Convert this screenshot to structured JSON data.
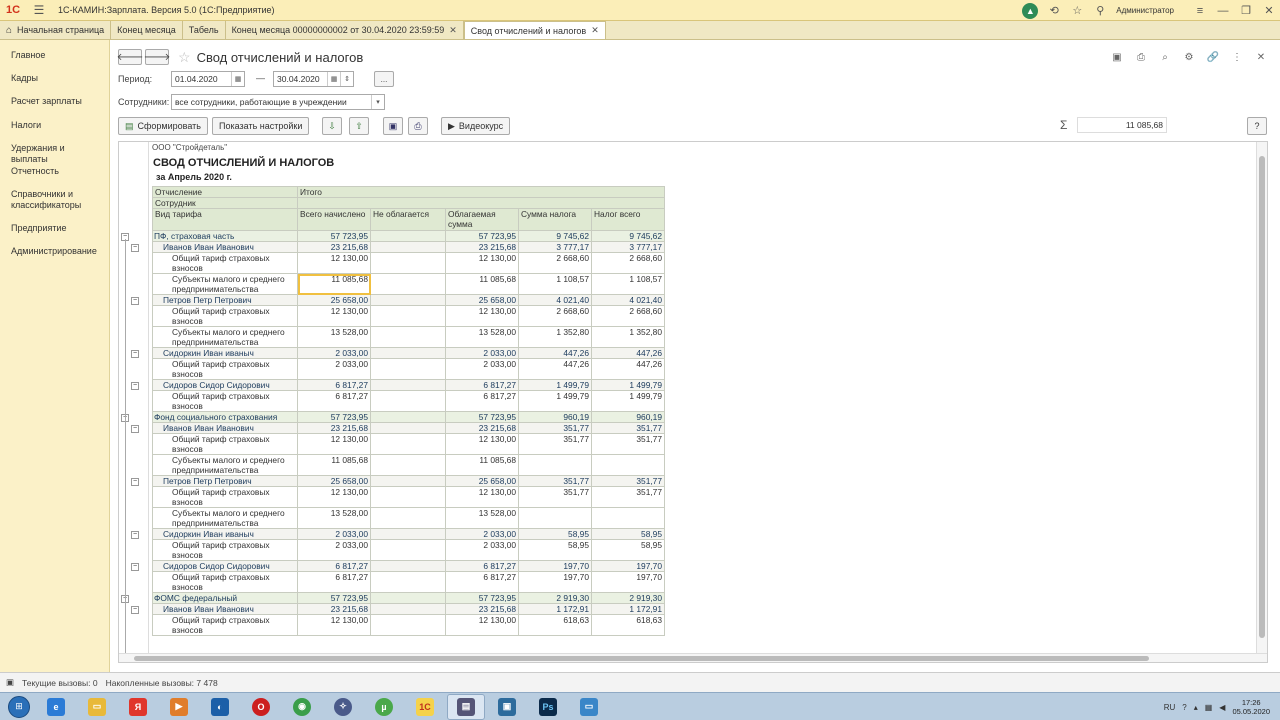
{
  "window": {
    "title": "1С-КАМИН:Зарплата. Версия 5.0  (1С:Предприятие)",
    "user": "Администратор"
  },
  "tabs": [
    {
      "label": "Начальная страница"
    },
    {
      "label": "Конец месяца"
    },
    {
      "label": "Табель"
    },
    {
      "label": "Конец месяца 00000000002 от 30.04.2020 23:59:59"
    },
    {
      "label": "Свод отчислений и налогов"
    }
  ],
  "sidebar": {
    "items": [
      "Главное",
      "Кадры",
      "Расчет зарплаты",
      "Налоги",
      "Удержания и выплаты",
      "Отчетность",
      "Справочники и классификаторы",
      "Предприятие",
      "Администрирование"
    ]
  },
  "form": {
    "title": "Свод отчислений и налогов",
    "period_label": "Период:",
    "date_from": "01.04.2020",
    "dash": "—",
    "date_to": "30.04.2020",
    "ellipsis": "...",
    "employees_label": "Сотрудники:",
    "employees_value": "все сотрудники, работающие в учреждении",
    "btn_generate": "Сформировать",
    "btn_settings": "Показать настройки",
    "btn_video": "Видеокурс",
    "sum_value": "11 085,68",
    "help": "?"
  },
  "report": {
    "org": "ООО \"Стройдеталь\"",
    "title": "СВОД ОТЧИСЛЕНИЙ И НАЛОГОВ",
    "period": "за Апрель 2020 г.",
    "header": {
      "h1": "Отчисление",
      "h_total": "Итого",
      "h2": "Сотрудник",
      "h3": "Вид тарифа",
      "c1": "Всего начислено",
      "c2": "Не облагается",
      "c3": "Облагаемая сумма",
      "c4": "Сумма налога",
      "c5": "Налог всего"
    },
    "rows": [
      {
        "lvl": 0,
        "name": "ПФ, страховая часть",
        "v": [
          "57 723,95",
          "",
          "57 723,95",
          "9 745,62",
          "9 745,62"
        ]
      },
      {
        "lvl": 1,
        "name": "Иванов Иван Иванович",
        "v": [
          "23 215,68",
          "",
          "23 215,68",
          "3 777,17",
          "3 777,17"
        ]
      },
      {
        "lvl": 2,
        "name": "Общий тариф страховых взносов",
        "v": [
          "12 130,00",
          "",
          "12 130,00",
          "2 668,60",
          "2 668,60"
        ]
      },
      {
        "lvl": 2,
        "name": "Субъекты малого и среднего предпринимательства",
        "v": [
          "11 085,68",
          "",
          "11 085,68",
          "1 108,57",
          "1 108,57"
        ],
        "sel": true
      },
      {
        "lvl": 1,
        "name": "Петров Петр Петрович",
        "v": [
          "25 658,00",
          "",
          "25 658,00",
          "4 021,40",
          "4 021,40"
        ]
      },
      {
        "lvl": 2,
        "name": "Общий тариф страховых взносов",
        "v": [
          "12 130,00",
          "",
          "12 130,00",
          "2 668,60",
          "2 668,60"
        ]
      },
      {
        "lvl": 2,
        "name": "Субъекты малого и среднего предпринимательства",
        "v": [
          "13 528,00",
          "",
          "13 528,00",
          "1 352,80",
          "1 352,80"
        ]
      },
      {
        "lvl": 1,
        "name": "Сидоркин Иван иваныч",
        "v": [
          "2 033,00",
          "",
          "2 033,00",
          "447,26",
          "447,26"
        ]
      },
      {
        "lvl": 2,
        "name": "Общий тариф страховых взносов",
        "v": [
          "2 033,00",
          "",
          "2 033,00",
          "447,26",
          "447,26"
        ]
      },
      {
        "lvl": 1,
        "name": "Сидоров Сидор Сидорович",
        "v": [
          "6 817,27",
          "",
          "6 817,27",
          "1 499,79",
          "1 499,79"
        ]
      },
      {
        "lvl": 2,
        "name": "Общий тариф страховых взносов",
        "v": [
          "6 817,27",
          "",
          "6 817,27",
          "1 499,79",
          "1 499,79"
        ]
      },
      {
        "lvl": 0,
        "name": "Фонд социального страхования",
        "v": [
          "57 723,95",
          "",
          "57 723,95",
          "960,19",
          "960,19"
        ]
      },
      {
        "lvl": 1,
        "name": "Иванов Иван Иванович",
        "v": [
          "23 215,68",
          "",
          "23 215,68",
          "351,77",
          "351,77"
        ]
      },
      {
        "lvl": 2,
        "name": "Общий тариф страховых взносов",
        "v": [
          "12 130,00",
          "",
          "12 130,00",
          "351,77",
          "351,77"
        ]
      },
      {
        "lvl": 2,
        "name": "Субъекты малого и среднего предпринимательства",
        "v": [
          "11 085,68",
          "",
          "11 085,68",
          "",
          ""
        ]
      },
      {
        "lvl": 1,
        "name": "Петров Петр Петрович",
        "v": [
          "25 658,00",
          "",
          "25 658,00",
          "351,77",
          "351,77"
        ]
      },
      {
        "lvl": 2,
        "name": "Общий тариф страховых взносов",
        "v": [
          "12 130,00",
          "",
          "12 130,00",
          "351,77",
          "351,77"
        ]
      },
      {
        "lvl": 2,
        "name": "Субъекты малого и среднего предпринимательства",
        "v": [
          "13 528,00",
          "",
          "13 528,00",
          "",
          ""
        ]
      },
      {
        "lvl": 1,
        "name": "Сидоркин Иван иваныч",
        "v": [
          "2 033,00",
          "",
          "2 033,00",
          "58,95",
          "58,95"
        ]
      },
      {
        "lvl": 2,
        "name": "Общий тариф страховых взносов",
        "v": [
          "2 033,00",
          "",
          "2 033,00",
          "58,95",
          "58,95"
        ]
      },
      {
        "lvl": 1,
        "name": "Сидоров Сидор Сидорович",
        "v": [
          "6 817,27",
          "",
          "6 817,27",
          "197,70",
          "197,70"
        ]
      },
      {
        "lvl": 2,
        "name": "Общий тариф страховых взносов",
        "v": [
          "6 817,27",
          "",
          "6 817,27",
          "197,70",
          "197,70"
        ]
      },
      {
        "lvl": 0,
        "name": "ФОМС федеральный",
        "v": [
          "57 723,95",
          "",
          "57 723,95",
          "2 919,30",
          "2 919,30"
        ]
      },
      {
        "lvl": 1,
        "name": "Иванов Иван Иванович",
        "v": [
          "23 215,68",
          "",
          "23 215,68",
          "1 172,91",
          "1 172,91"
        ]
      },
      {
        "lvl": 2,
        "name": "Общий тариф страховых взносов",
        "v": [
          "12 130,00",
          "",
          "12 130,00",
          "618,63",
          "618,63"
        ]
      }
    ]
  },
  "status": {
    "current_calls": "Текущие вызовы: 0",
    "accumulated_calls": "Накопленные вызовы: 7 478"
  },
  "taskbar": {
    "lang": "RU",
    "time": "17:26",
    "date": "05.05.2020"
  }
}
